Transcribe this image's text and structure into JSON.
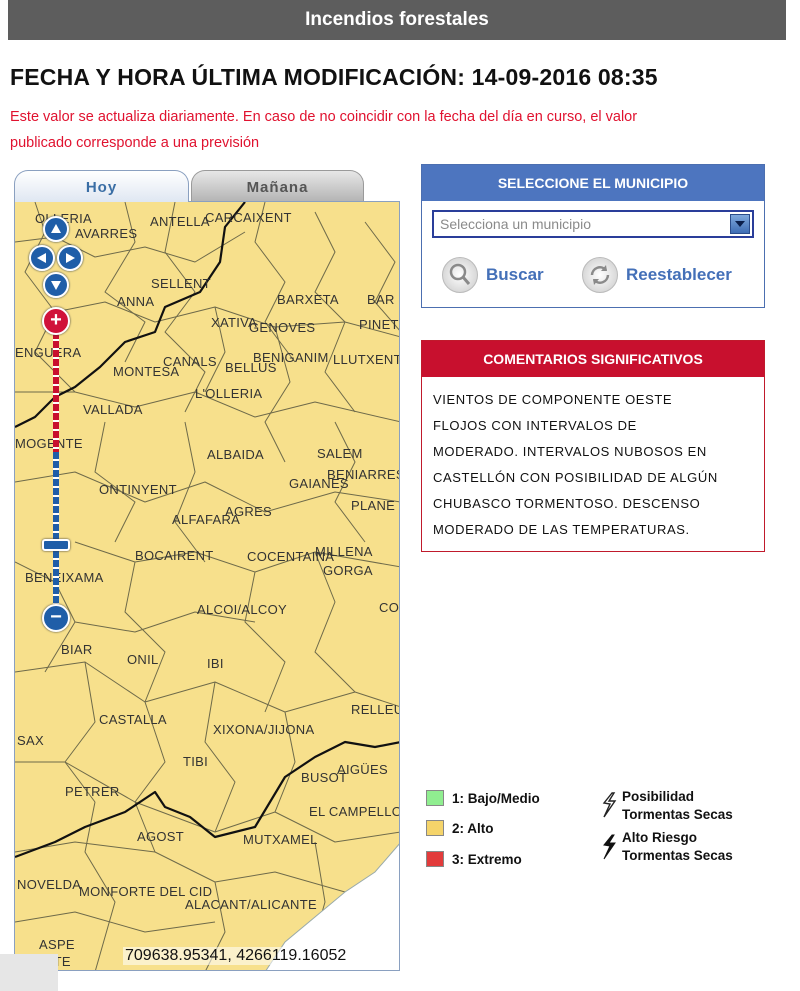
{
  "header": {
    "title": "Incendios forestales"
  },
  "update": {
    "title": "FECHA Y HORA ÚLTIMA MODIFICACIÓN: 14-09-2016 08:35",
    "notice_line1": "Este valor se actualiza diariamente. En caso de no coincidir con la fecha del día en curso, el valor",
    "notice_line2": "publicado corresponde a una previsión"
  },
  "tabs": [
    {
      "label": "Hoy",
      "active": true
    },
    {
      "label": "Mañana",
      "active": false
    }
  ],
  "map": {
    "labels": [
      "CARCAIXENT",
      "ANTELLA",
      "OLLERIA",
      "AVARRES",
      "ANNA",
      "SELLENT",
      "BARXETA",
      "BAR",
      "ENGUERA",
      "XATIVA",
      "GENOVES",
      "PINET",
      "CANALS",
      "BELLUS",
      "BENIGANIM",
      "LLUTXENT",
      "MONTESA",
      "L'OLLERIA",
      "VALLADA",
      "MOGENTE",
      "ALBAIDA",
      "SALEM",
      "BENIARRES",
      "GAIANES",
      "PLANE",
      "ONTINYENT",
      "AGRES",
      "ALFAFARA",
      "BOCAIRENT",
      "COCENTAINA",
      "MILLENA",
      "GORGA",
      "BENEIXAMA",
      "ALCOI/ALCOY",
      "CO",
      "BIAR",
      "ONIL",
      "IBI",
      "RELLEU",
      "CASTALLA",
      "SAX",
      "XIXONA/JIJONA",
      "TIBI",
      "BUSOT",
      "AIGÜES",
      "PETRER",
      "EL CAMPELLO",
      "AGOST",
      "MUTXAMEL",
      "NOVELDA",
      "MONFORTE DEL CID",
      "ALACANT/ALICANTE",
      "ASPE",
      "FUENTE"
    ],
    "coord_x": "709638.95341",
    "coord_y": "4266119.16052",
    "fill_color": "#f7e08c",
    "controls": {
      "pan_up": "arrow-up-icon",
      "pan_left": "arrow-left-icon",
      "pan_right": "arrow-right-icon",
      "pan_down": "arrow-down-icon",
      "zoom_in": "+",
      "zoom_out": "−"
    }
  },
  "municipio": {
    "title": "SELECCIONE EL MUNICIPIO",
    "placeholder": "Selecciona un municipio",
    "buscar": "Buscar",
    "reestablecer": "Reestablecer",
    "accent": "#4d75bf"
  },
  "comentarios": {
    "title": "COMENTARIOS SIGNIFICATIVOS",
    "lines": [
      "VIENTOS DE COMPONENTE OESTE",
      "FLOJOS CON INTERVALOS DE",
      "MODERADO. INTERVALOS NUBOSOS EN",
      "CASTELLÓN CON POSIBILIDAD DE ALGÚN",
      "CHUBASCO TORMENTOSO. DESCENSO",
      "MODERADO DE LAS TEMPERATURAS."
    ],
    "accent": "#c8102e"
  },
  "legend": {
    "levels": [
      {
        "label": "1: Bajo/Medio",
        "color": "#90ee90"
      },
      {
        "label": "2: Alto",
        "color": "#f5d46a"
      },
      {
        "label": "3: Extremo",
        "color": "#e23b3b"
      }
    ],
    "storms": [
      {
        "line1": "Posibilidad",
        "line2": "Tormentas Secas",
        "icon": "lightning-outline-icon"
      },
      {
        "line1": "Alto Riesgo",
        "line2": "Tormentas Secas",
        "icon": "lightning-solid-icon"
      }
    ]
  }
}
